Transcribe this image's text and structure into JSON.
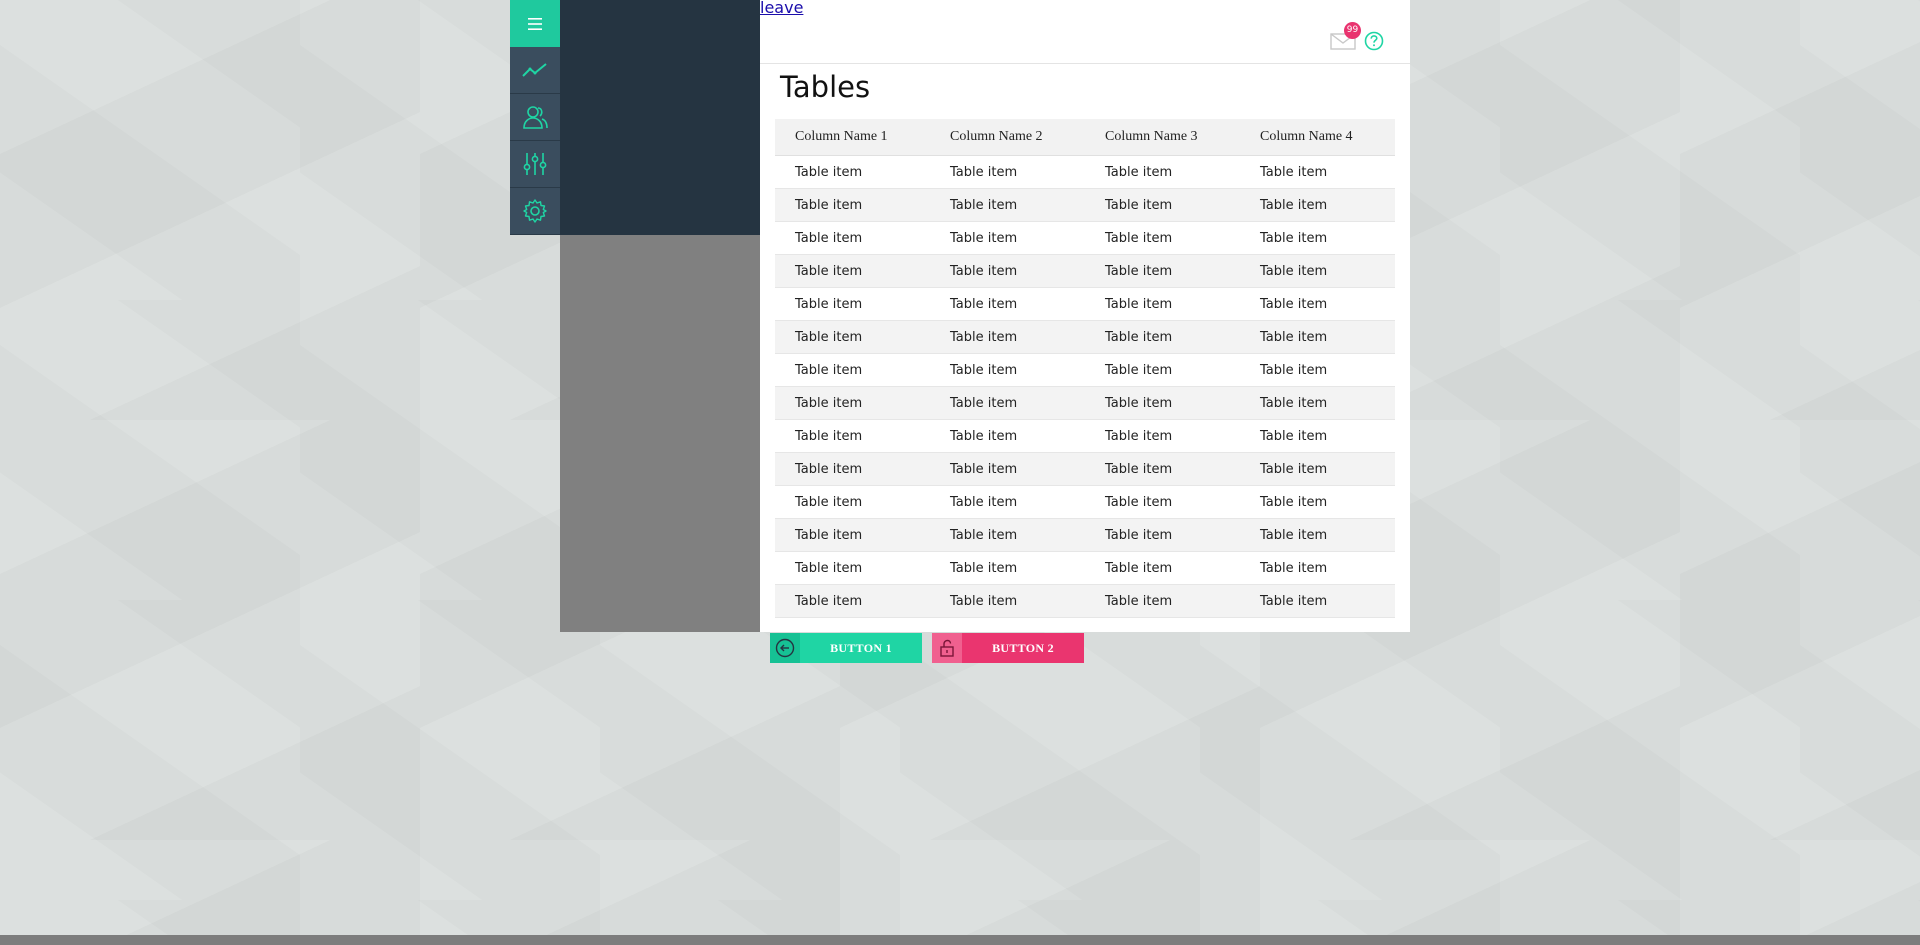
{
  "header": {
    "leave_link": "leave",
    "notifications_count": "99"
  },
  "main": {
    "title": "Tables"
  },
  "table": {
    "columns": [
      "Column Name 1",
      "Column Name 2",
      "Column Name 3",
      "Column Name 4"
    ],
    "rows": [
      [
        "Table item",
        "Table item",
        "Table item",
        "Table item"
      ],
      [
        "Table item",
        "Table item",
        "Table item",
        "Table item"
      ],
      [
        "Table item",
        "Table item",
        "Table item",
        "Table item"
      ],
      [
        "Table item",
        "Table item",
        "Table item",
        "Table item"
      ],
      [
        "Table item",
        "Table item",
        "Table item",
        "Table item"
      ],
      [
        "Table item",
        "Table item",
        "Table item",
        "Table item"
      ],
      [
        "Table item",
        "Table item",
        "Table item",
        "Table item"
      ],
      [
        "Table item",
        "Table item",
        "Table item",
        "Table item"
      ],
      [
        "Table item",
        "Table item",
        "Table item",
        "Table item"
      ],
      [
        "Table item",
        "Table item",
        "Table item",
        "Table item"
      ],
      [
        "Table item",
        "Table item",
        "Table item",
        "Table item"
      ],
      [
        "Table item",
        "Table item",
        "Table item",
        "Table item"
      ],
      [
        "Table item",
        "Table item",
        "Table item",
        "Table item"
      ],
      [
        "Table item",
        "Table item",
        "Table item",
        "Table item"
      ]
    ]
  },
  "buttons": {
    "button1_label": "BUTTON 1",
    "button2_label": "BUTTON 2"
  },
  "sidebar": {
    "icons": [
      "menu-icon",
      "trend-chart-icon",
      "users-icon",
      "sliders-icon",
      "gear-icon"
    ]
  },
  "icons": {
    "back": "arrow-left-circle-icon",
    "mail": "envelope-icon",
    "help": "question-circle-icon",
    "button1": "arrow-left-circle-icon",
    "button2": "unlock-icon"
  },
  "colors": {
    "accent_green": "#1fd5a4",
    "accent_pink": "#ea356f",
    "sidebar_dark": "#253441",
    "rail": "#3a4d5e"
  }
}
